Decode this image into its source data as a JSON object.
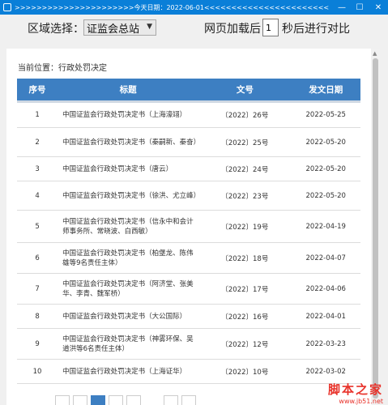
{
  "window": {
    "title": ">>>>>>>>>>>>>>>>>>>>>>今天日期：2022-06-01<<<<<<<<<<<<<<<<<<<<<<<",
    "minimize": "—",
    "maximize": "☐",
    "close": "✕"
  },
  "controls": {
    "region_label": "区域选择：",
    "region_value": "证监会总站",
    "delay_prefix": "网页加载后",
    "delay_value": "1",
    "delay_suffix": "秒后进行对比"
  },
  "page": {
    "breadcrumb": "当前位置：行政处罚决定"
  },
  "table": {
    "headers": {
      "seq": "序号",
      "title": "标题",
      "doc": "文号",
      "date": "发文日期"
    },
    "rows": [
      {
        "seq": "1",
        "title": "中国证监会行政处罚决定书（上海濠翊）",
        "doc": "〔2022〕26号",
        "date": "2022-05-25"
      },
      {
        "seq": "2",
        "title": "中国证监会行政处罚决定书（秦嗣新、秦奋）",
        "doc": "〔2022〕25号",
        "date": "2022-05-20"
      },
      {
        "seq": "3",
        "title": "中国证监会行政处罚决定书（唐云）",
        "doc": "〔2022〕24号",
        "date": "2022-05-20"
      },
      {
        "seq": "4",
        "title": "中国证监会行政处罚决定书（徐洪、尤立峰）",
        "doc": "〔2022〕23号",
        "date": "2022-05-20"
      },
      {
        "seq": "5",
        "title": "中国证监会行政处罚决定书（信永中和会计师事务所、常晓波、白西敏）",
        "doc": "〔2022〕19号",
        "date": "2022-04-19"
      },
      {
        "seq": "6",
        "title": "中国证监会行政处罚决定书（柏堡龙、陈伟雄等9名责任主体）",
        "doc": "〔2022〕18号",
        "date": "2022-04-07"
      },
      {
        "seq": "7",
        "title": "中国证监会行政处罚决定书（阿济堂、张美华、李青、魏军桥）",
        "doc": "〔2022〕17号",
        "date": "2022-04-06"
      },
      {
        "seq": "8",
        "title": "中国证监会行政处罚决定书（大公国际）",
        "doc": "〔2022〕16号",
        "date": "2022-04-01"
      },
      {
        "seq": "9",
        "title": "中国证监会行政处罚决定书（神雾环保、吴道洪等6名责任主体）",
        "doc": "〔2022〕12号",
        "date": "2022-03-23"
      },
      {
        "seq": "10",
        "title": "中国证监会行政处罚决定书（上海证华）",
        "doc": "〔2022〕10号",
        "date": "2022-03-02"
      }
    ]
  },
  "watermark": {
    "line1": "脚本之家",
    "line2": "www.jb51.net"
  },
  "colors": {
    "header_bg": "#3d7fc2",
    "titlebar_bg": "#0a7fd8"
  }
}
